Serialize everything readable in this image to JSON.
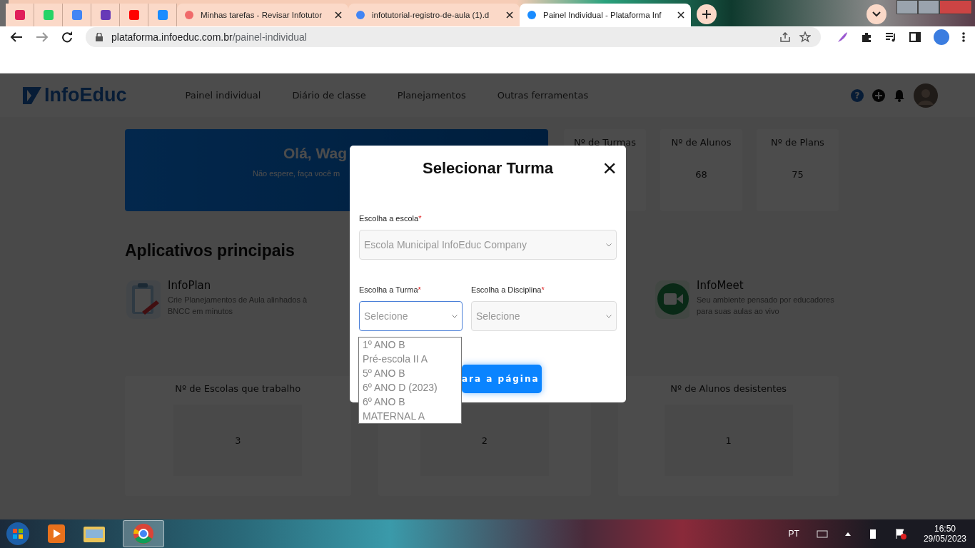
{
  "browser": {
    "tabs": [
      {
        "title": "Minhas tarefas - Revisar Infotutor",
        "selected": false
      },
      {
        "title": "infotutorial-registro-de-aula (1).d",
        "selected": false
      },
      {
        "title": "Painel Individual - Plataforma Inf",
        "selected": true
      }
    ],
    "url_host": "plataforma.infoeduc.com.br",
    "url_path": "/painel-individual"
  },
  "header": {
    "logo": "InfoEduc",
    "nav": [
      "Painel individual",
      "Diário de classe",
      "Planejamentos",
      "Outras ferramentas"
    ],
    "help": "?"
  },
  "banner": {
    "greeting": "Olá, Wag",
    "subtitle": "Não espere, faça você m"
  },
  "stats": [
    {
      "label": "Nº de Turmas"
    },
    {
      "label": "Nº de Alunos",
      "value": "68"
    },
    {
      "label": "Nº de Plans",
      "value": "75"
    }
  ],
  "apps_title": "Aplicativos principais",
  "apps": [
    {
      "kind": "plan",
      "name": "InfoPlan",
      "description": "Crie Planejamentos de Aula alinhados à BNCC em minutos"
    },
    {
      "kind": "meet",
      "name": "InfoMeet",
      "description": "Seu ambiente pensado por educadores para suas aulas ao vivo"
    }
  ],
  "summary_cards": [
    {
      "label": "Nº de Escolas que trabalho",
      "value": "3"
    },
    {
      "value": "2"
    },
    {
      "label": "Nº de Alunos desistentes",
      "value": "1"
    }
  ],
  "modal": {
    "title": "Selecionar Turma",
    "close": "×",
    "school": {
      "label": "Escolha a escola",
      "required": "*",
      "value": "Escola Municipal InfoEduc Company"
    },
    "class": {
      "label": "Escolha a Turma",
      "required": "*",
      "placeholder": "Selecione",
      "options": [
        "1º ANO B",
        "Pré-escola II A",
        "5º ANO B",
        "6º ANO D (2023)",
        "6º ANO B",
        "MATERNAL A"
      ]
    },
    "subject": {
      "label": "Escolha a Disciplina",
      "required": "*",
      "placeholder": "Selecione"
    },
    "button": "ara a página"
  },
  "taskbar": {
    "language": "PT",
    "time": "16:50",
    "date": "29/05/2023"
  }
}
